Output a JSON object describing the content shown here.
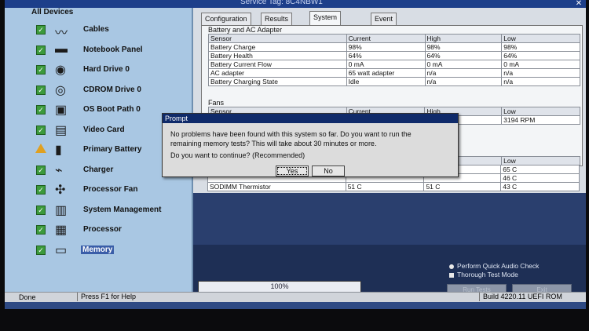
{
  "window": {
    "title": "Service Tag: 8C4NBW1"
  },
  "left_panel": {
    "header": "All Devices",
    "devices": [
      {
        "label": "Cables",
        "status": "pass",
        "icon": "cable-icon"
      },
      {
        "label": "Notebook Panel",
        "status": "pass",
        "icon": "monitor-icon"
      },
      {
        "label": "Hard Drive 0",
        "status": "pass",
        "icon": "hard-drive-icon"
      },
      {
        "label": "CDROM Drive 0",
        "status": "pass",
        "icon": "cdrom-icon"
      },
      {
        "label": "OS Boot Path 0",
        "status": "pass",
        "icon": "boot-path-icon"
      },
      {
        "label": "Video Card",
        "status": "pass",
        "icon": "video-card-icon"
      },
      {
        "label": "Primary Battery",
        "status": "warning",
        "icon": "battery-icon"
      },
      {
        "label": "Charger",
        "status": "pass",
        "icon": "charger-icon"
      },
      {
        "label": "Processor Fan",
        "status": "pass",
        "icon": "fan-icon"
      },
      {
        "label": "System Management",
        "status": "pass",
        "icon": "system-management-icon"
      },
      {
        "label": "Processor",
        "status": "pass",
        "icon": "processor-icon"
      },
      {
        "label": "Memory",
        "status": "pass",
        "icon": "memory-icon"
      }
    ]
  },
  "tabs": [
    "Configuration",
    "Results",
    "System Health",
    "Event Log"
  ],
  "active_tab": "System Health",
  "battery_section": {
    "title": "Battery and AC Adapter",
    "headers": [
      "Sensor",
      "Current",
      "High",
      "Low"
    ],
    "rows": [
      [
        "Battery Charge",
        "98%",
        "98%",
        "98%"
      ],
      [
        "Battery Health",
        "64%",
        "64%",
        "64%"
      ],
      [
        "Battery Current Flow",
        "0 mA",
        "0 mA",
        "0 mA"
      ],
      [
        "AC adapter",
        "65 watt adapter",
        "n/a",
        "n/a"
      ],
      [
        "Battery Charging State",
        "Idle",
        "n/a",
        "n/a"
      ]
    ]
  },
  "fans_section": {
    "title": "Fans",
    "headers": [
      "Sensor",
      "Current",
      "High",
      "Low"
    ],
    "visible_low": "3194 RPM"
  },
  "temp_section": {
    "header_low": "Low",
    "low_values": [
      "65 C",
      "46 C",
      "43 C"
    ],
    "last_row": [
      "SODIMM Thermistor",
      "51 C",
      "51 C",
      "43 C"
    ]
  },
  "dialog": {
    "title": "Prompt",
    "lines": [
      "No problems have been found with this system so far. Do you want to run the",
      "remaining memory tests?  This will take about 30 minutes or more.",
      "Do you want to continue? (Recommended)"
    ],
    "yes_label": "Yes",
    "no_label": "No"
  },
  "progress": {
    "text": "100%",
    "fraction": 1.0
  },
  "options": {
    "quick_audio": "Perform Quick Audio Check",
    "thorough": "Thorough Test Mode"
  },
  "buttons": {
    "run_tests": "Run Tests",
    "exit": "Exit"
  },
  "status_bar": {
    "left": "Done",
    "help": "Press F1 for Help",
    "build": "Build  4220.11  UEFI ROM"
  },
  "colors": {
    "title_bar": "#1d3f8a",
    "left_panel": "#a9c7e3",
    "pass": "#3c9a3c",
    "warning": "#e0a020",
    "dialog_title": "#0f2a6a"
  }
}
